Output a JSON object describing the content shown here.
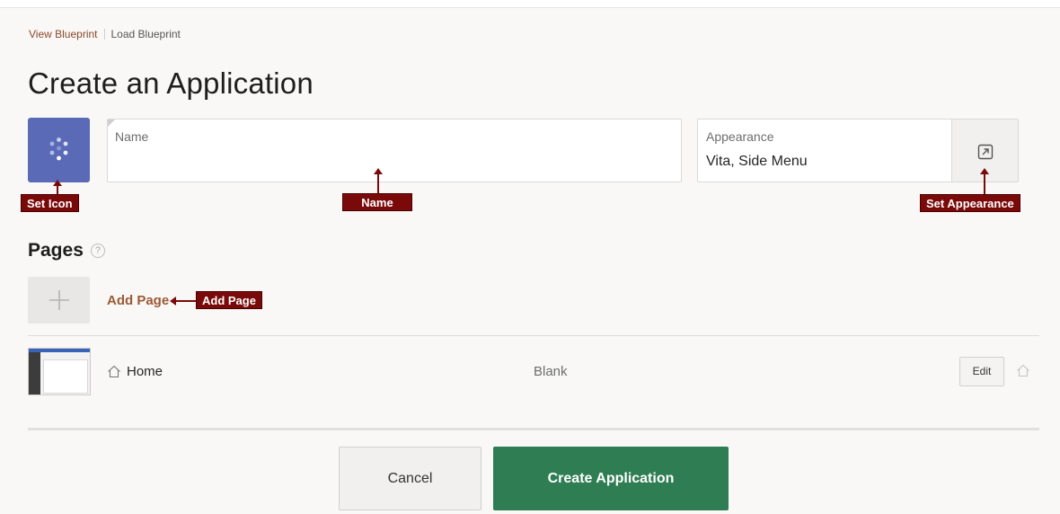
{
  "header": {
    "links": [
      "View Blueprint",
      "Load Blueprint"
    ],
    "title": "Create an Application"
  },
  "form": {
    "name_label": "Name",
    "name_value": "",
    "appearance_label": "Appearance",
    "appearance_value": "Vita, Side Menu"
  },
  "callouts": {
    "set_icon": "Set Icon",
    "name": "Name",
    "set_appearance": "Set Appearance",
    "add_page": "Add Page"
  },
  "pages": {
    "heading": "Pages",
    "help_glyph": "?",
    "add_page_label": "Add Page",
    "rows": [
      {
        "name": "Home",
        "type": "Blank",
        "edit_label": "Edit"
      }
    ]
  },
  "actions": {
    "cancel": "Cancel",
    "create": "Create Application"
  },
  "colors": {
    "icon_tile": "#5b6ab6",
    "primary": "#2f7d52",
    "link": "#9b5a34",
    "callout": "#7a0a0a"
  }
}
